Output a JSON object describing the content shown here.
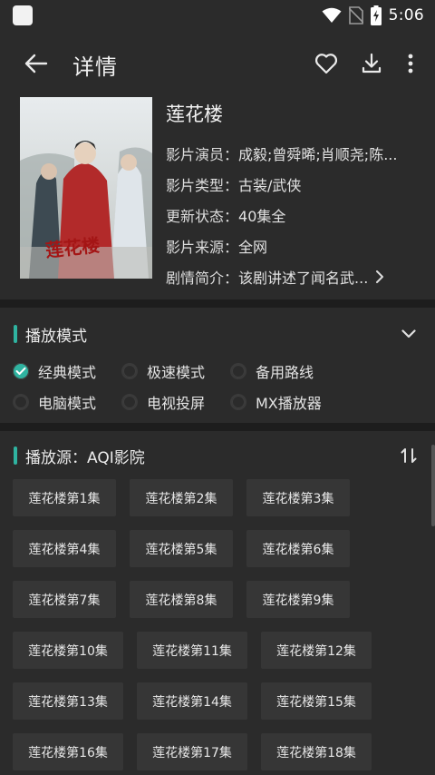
{
  "status_bar": {
    "time": "5:06"
  },
  "app_bar": {
    "title": "详情"
  },
  "movie": {
    "title": "莲花楼",
    "fields": [
      {
        "key": "影片演员：",
        "value": "成毅;曾舜晞;肖顺尧;陈..."
      },
      {
        "key": "影片类型：",
        "value": "古装/武侠"
      },
      {
        "key": "更新状态：",
        "value": "40集全"
      },
      {
        "key": "影片来源：",
        "value": "全网"
      }
    ],
    "synopsis": {
      "key": "剧情简介：",
      "value": "该剧讲述了闻名武..."
    },
    "poster_text": "莲花楼"
  },
  "play_mode": {
    "title": "播放模式",
    "options_row1": [
      {
        "label": "经典模式",
        "checked": true
      },
      {
        "label": "极速模式",
        "checked": false
      },
      {
        "label": "备用路线",
        "checked": false
      }
    ],
    "options_row2": [
      {
        "label": "电脑模式",
        "checked": false
      },
      {
        "label": "电视投屏",
        "checked": false
      },
      {
        "label": "MX播放器",
        "checked": false
      }
    ]
  },
  "source": {
    "title": "播放源：AQI影院",
    "episodes": [
      [
        "莲花楼第1集",
        "莲花楼第2集",
        "莲花楼第3集"
      ],
      [
        "莲花楼第4集",
        "莲花楼第5集",
        "莲花楼第6集"
      ],
      [
        "莲花楼第7集",
        "莲花楼第8集",
        "莲花楼第9集"
      ],
      [
        "莲花楼第10集",
        "莲花楼第11集",
        "莲花楼第12集"
      ],
      [
        "莲花楼第13集",
        "莲花楼第14集",
        "莲花楼第15集"
      ],
      [
        "莲花楼第16集",
        "莲花楼第17集",
        "莲花楼第18集"
      ]
    ]
  },
  "colors": {
    "background": "#2b2b2b",
    "accent": "#2fb3a0",
    "divider": "#1d1d1d",
    "chip": "#363636"
  }
}
